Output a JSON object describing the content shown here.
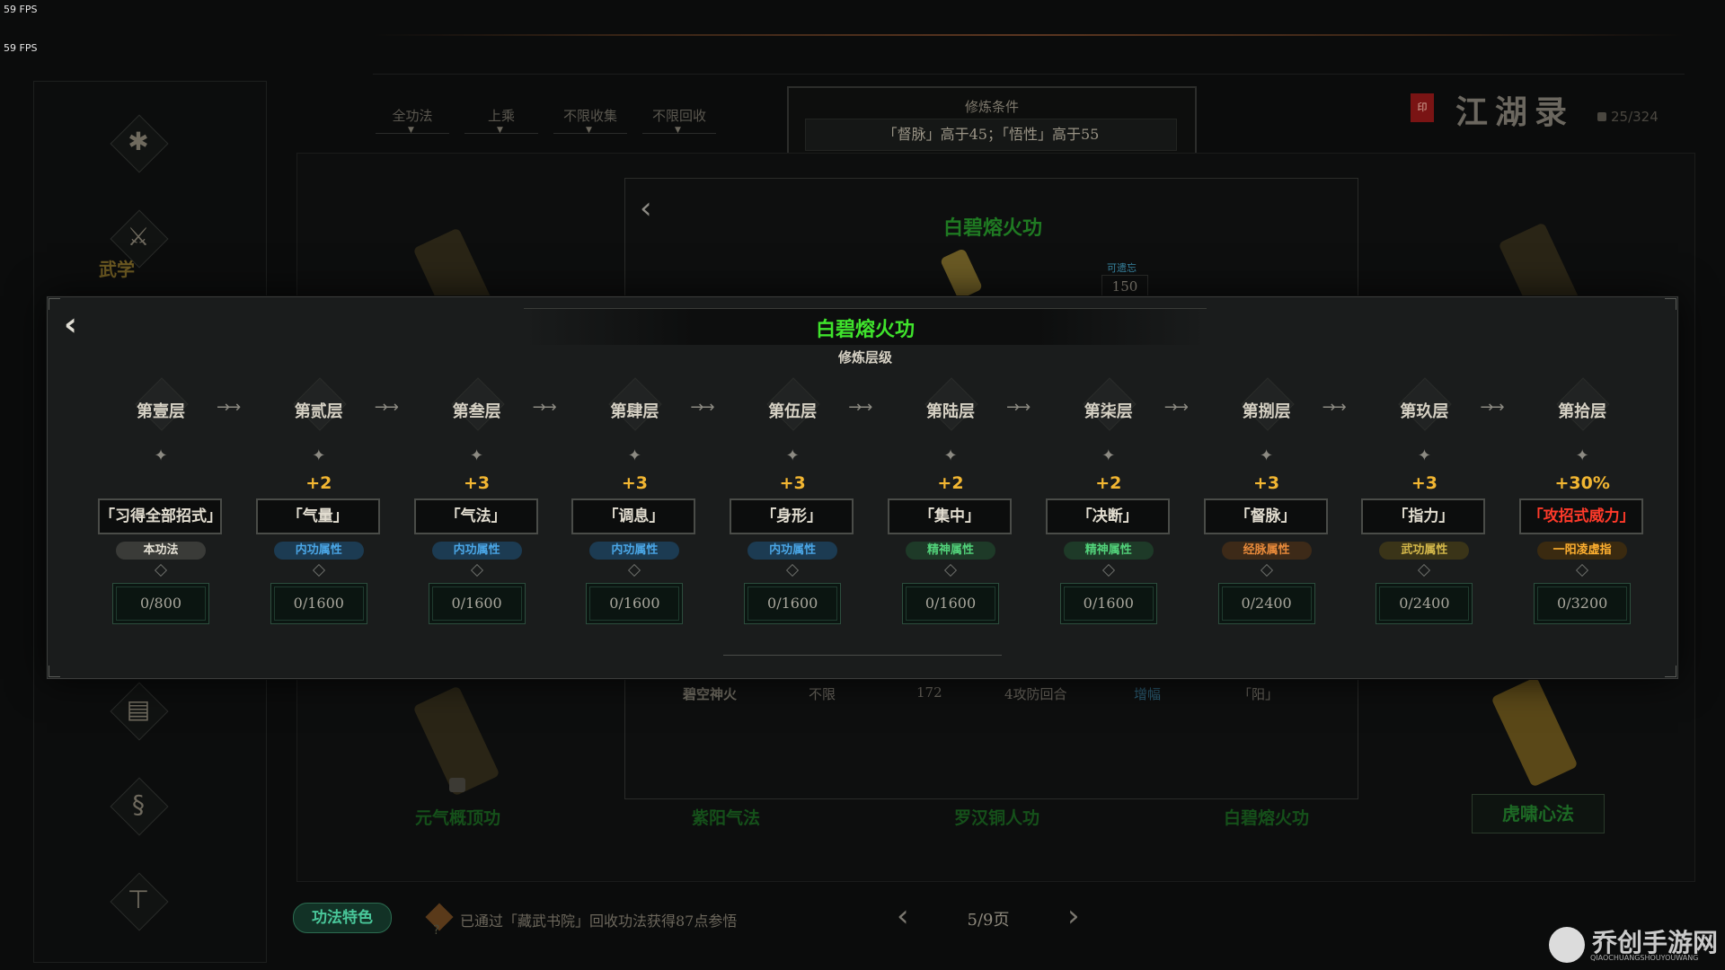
{
  "fps": [
    "59 FPS",
    "59 FPS"
  ],
  "sidebar": {
    "active_label": "武学",
    "icons": [
      "beetle-icon",
      "martial-arts-icon",
      "book-icon",
      "gourd-icon",
      "robe-icon"
    ]
  },
  "filters": [
    "全功法",
    "上乘",
    "不限收集",
    "不限回收"
  ],
  "condition": {
    "title": "修炼条件",
    "value": "「督脉」高于45；「悟性」高于55"
  },
  "header": {
    "seal": "印",
    "title": "江湖录",
    "count": "25/324"
  },
  "bg_card": {
    "title": "白碧熔火功",
    "forget_label": "可遗忘",
    "forget_value": "150",
    "row": {
      "name": "碧空神火",
      "limit": "不限",
      "value": "172",
      "turns": "4攻防回合",
      "effect": "增幅",
      "attr": "「阳」"
    }
  },
  "bg_names": [
    "元气概顶功",
    "紫阳气法",
    "罗汉铜人功",
    "白碧熔火功"
  ],
  "tiger_button": "虎啸心法",
  "modal": {
    "title": "白碧熔火功",
    "subtitle": "修炼层级",
    "levels": [
      {
        "name": "第壹层",
        "bonus": "",
        "attr": "「习得全部招式」",
        "tag": "本功法",
        "tag_color": "gray",
        "progress": "0/800"
      },
      {
        "name": "第贰层",
        "bonus": "+2",
        "attr": "「气量」",
        "tag": "内功属性",
        "tag_color": "blue",
        "progress": "0/1600"
      },
      {
        "name": "第叁层",
        "bonus": "+3",
        "attr": "「气法」",
        "tag": "内功属性",
        "tag_color": "blue",
        "progress": "0/1600"
      },
      {
        "name": "第肆层",
        "bonus": "+3",
        "attr": "「调息」",
        "tag": "内功属性",
        "tag_color": "blue",
        "progress": "0/1600"
      },
      {
        "name": "第伍层",
        "bonus": "+3",
        "attr": "「身形」",
        "tag": "内功属性",
        "tag_color": "blue",
        "progress": "0/1600"
      },
      {
        "name": "第陆层",
        "bonus": "+2",
        "attr": "「集中」",
        "tag": "精神属性",
        "tag_color": "green",
        "progress": "0/1600"
      },
      {
        "name": "第柒层",
        "bonus": "+2",
        "attr": "「决断」",
        "tag": "精神属性",
        "tag_color": "green",
        "progress": "0/1600"
      },
      {
        "name": "第捌层",
        "bonus": "+3",
        "attr": "「督脉」",
        "tag": "经脉属性",
        "tag_color": "orange",
        "progress": "0/2400"
      },
      {
        "name": "第玖层",
        "bonus": "+3",
        "attr": "「指力」",
        "tag": "武功属性",
        "tag_color": "gold",
        "progress": "0/2400"
      },
      {
        "name": "第拾层",
        "bonus": "+30%",
        "attr": "「攻招式威力」",
        "tag": "一阳凌虚指",
        "tag_color": "goldhot",
        "progress": "0/3200",
        "attr_red": true
      }
    ]
  },
  "bottom": {
    "feature_button": "功法特色",
    "message": "已通过「藏武书院」回收功法获得87点参悟",
    "page": "5/9页"
  },
  "watermark": {
    "text": "乔创手游网",
    "sub": "QIAOCHUANGSHOUYOUWANG"
  }
}
